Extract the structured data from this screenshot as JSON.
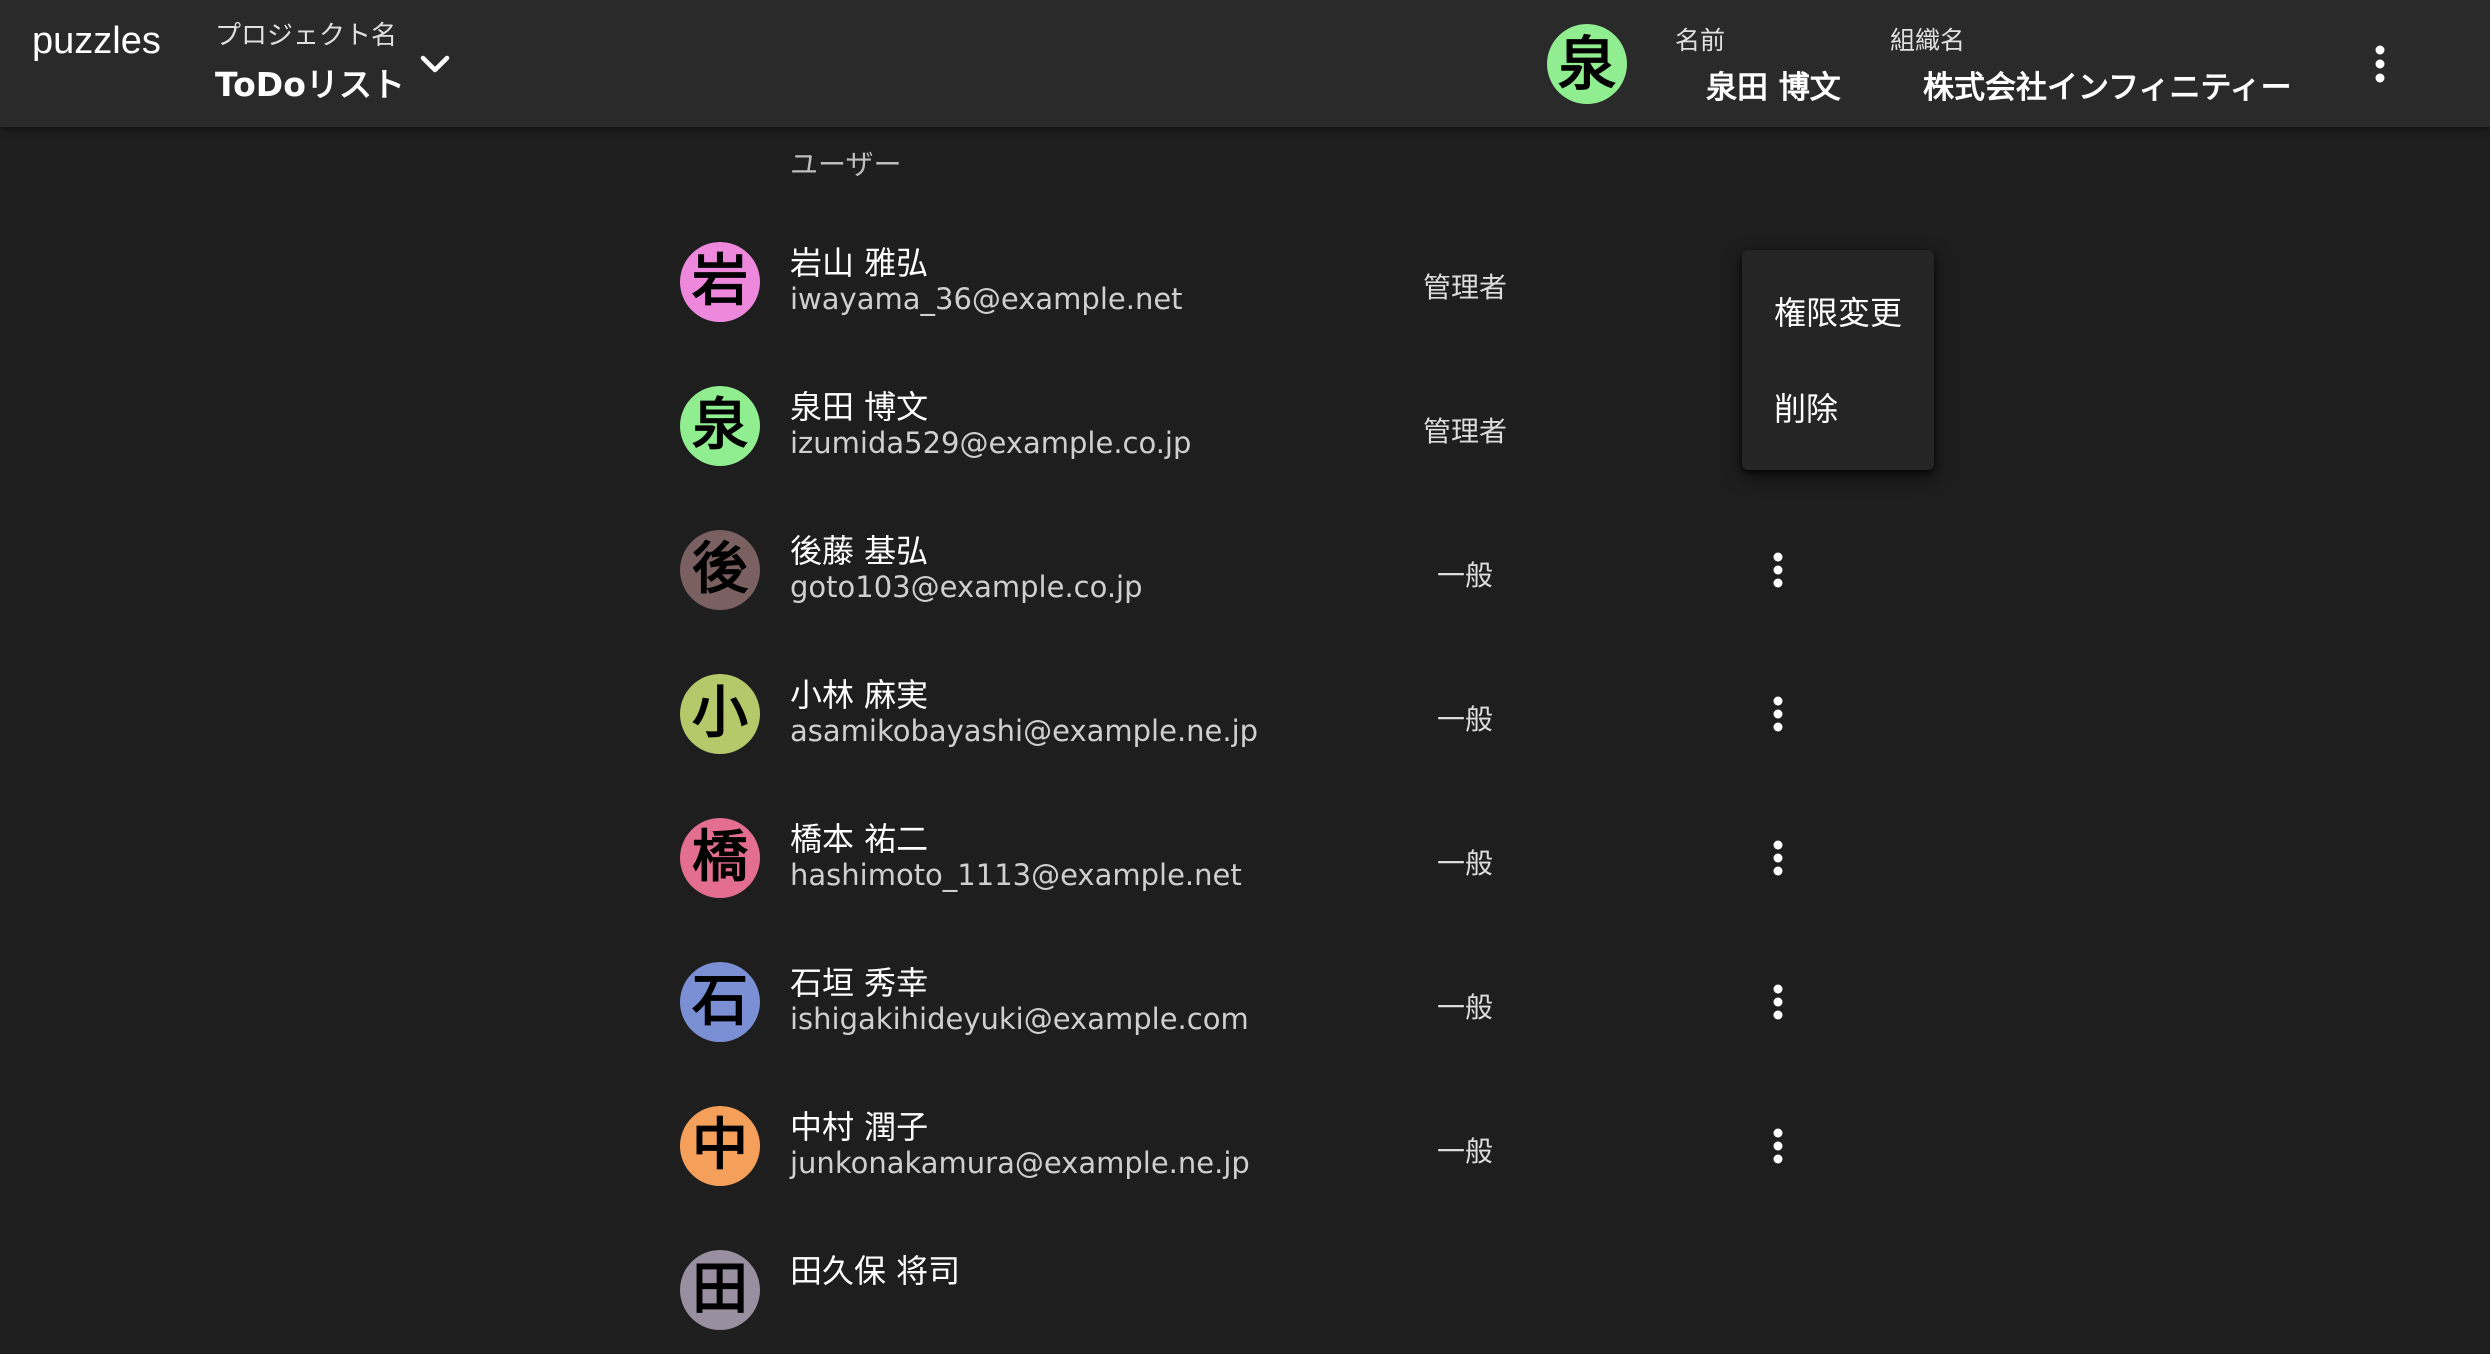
{
  "appbar": {
    "brand": "puzzles",
    "project_label": "プロジェクト名",
    "project_name": "ToDoリスト",
    "user_avatar_char": "泉",
    "user_avatar_color": "#90ee90",
    "name_label": "名前",
    "name_value": "泉田 博文",
    "org_label": "組織名",
    "org_value": "株式会社インフィニティー"
  },
  "section_title": "ユーザー",
  "users": [
    {
      "initial": "岩",
      "color": "#ee88dd",
      "name": "岩山 雅弘",
      "email": "iwayama_36@example.net",
      "role": "管理者"
    },
    {
      "initial": "泉",
      "color": "#90ee90",
      "name": "泉田 博文",
      "email": "izumida529@example.co.jp",
      "role": "管理者"
    },
    {
      "initial": "後",
      "color": "#7a6060",
      "name": "後藤 基弘",
      "email": "goto103@example.co.jp",
      "role": "一般"
    },
    {
      "initial": "小",
      "color": "#b5c96a",
      "name": "小林 麻実",
      "email": "asamikobayashi@example.ne.jp",
      "role": "一般"
    },
    {
      "initial": "橋",
      "color": "#e36e90",
      "name": "橋本 祐二",
      "email": "hashimoto_1113@example.net",
      "role": "一般"
    },
    {
      "initial": "石",
      "color": "#7b8fd4",
      "name": "石垣 秀幸",
      "email": "ishigakihideyuki@example.com",
      "role": "一般"
    },
    {
      "initial": "中",
      "color": "#f5a05a",
      "name": "中村 潤子",
      "email": "junkonakamura@example.ne.jp",
      "role": "一般"
    },
    {
      "initial": "田",
      "color": "#9a8fa0",
      "name": "田久保 将司",
      "email": "",
      "role": ""
    }
  ],
  "context_menu": {
    "items": [
      "権限変更",
      "削除"
    ]
  },
  "icons": {
    "project_dropdown": "chevron-down-icon",
    "app_menu": "more-vert-icon",
    "row_menu": "more-vert-icon"
  }
}
